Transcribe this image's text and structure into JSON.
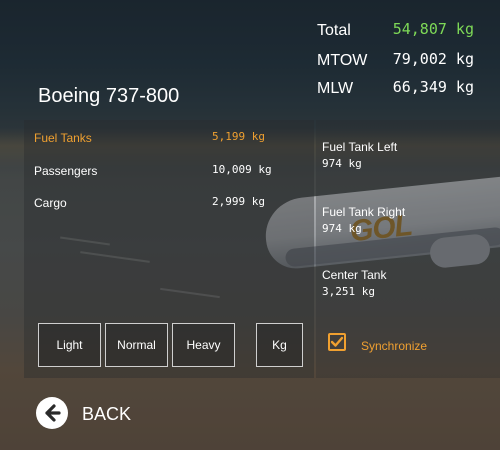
{
  "summary": {
    "total_label": "Total",
    "total_value": "54,807 kg",
    "mtow_label": "MTOW",
    "mtow_value": "79,002 kg",
    "mlw_label": "MLW",
    "mlw_value": "66,349 kg"
  },
  "aircraft": {
    "title": "Boeing 737-800"
  },
  "payload": [
    {
      "label": "Fuel Tanks",
      "value": "5,199 kg"
    },
    {
      "label": "Passengers",
      "value": "10,009 kg"
    },
    {
      "label": "Cargo",
      "value": "2,999 kg"
    }
  ],
  "tanks": [
    {
      "label": "Fuel Tank Left",
      "value": "974 kg"
    },
    {
      "label": "Fuel Tank Right",
      "value": "974 kg"
    },
    {
      "label": "Center Tank",
      "value": "3,251 kg"
    }
  ],
  "buttons": {
    "light": "Light",
    "normal": "Normal",
    "heavy": "Heavy",
    "unit": "Kg"
  },
  "synchronize": {
    "label": "Synchronize",
    "checked": true
  },
  "back": {
    "label": "BACK"
  },
  "colors": {
    "accent": "#f0a030",
    "total_value": "#7ed957",
    "text": "#ffffff"
  },
  "scene": {
    "livery_text": "GOL"
  }
}
